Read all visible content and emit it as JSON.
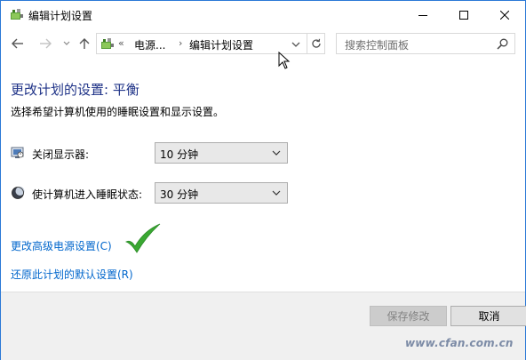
{
  "window": {
    "title": "编辑计划设置",
    "accent_color": "#2b79d6"
  },
  "nav": {
    "back_icon": "back-arrow-icon",
    "forward_icon": "forward-arrow-icon",
    "recent_icon": "chevron-down-icon",
    "up_icon": "up-arrow-icon",
    "address": {
      "overflow": "«",
      "segment1": "电源...",
      "separator": "›",
      "segment2": "编辑计划设置"
    },
    "search_placeholder": "搜索控制面板"
  },
  "main": {
    "heading": "更改计划的设置: 平衡",
    "subtitle": "选择希望计算机使用的睡眠设置和显示设置。",
    "display_row": {
      "label": "关闭显示器:",
      "value": "10 分钟"
    },
    "sleep_row": {
      "label": "使计算机进入睡眠状态:",
      "value": "30 分钟"
    },
    "advanced_link": "更改高级电源设置(C)",
    "restore_link": "还原此计划的默认设置(R)",
    "heading_color": "#1e3287",
    "link_color": "#0066cc"
  },
  "footer": {
    "save_label": "保存修改",
    "cancel_label": "取消"
  },
  "watermark": "www.cfan.com.cn"
}
